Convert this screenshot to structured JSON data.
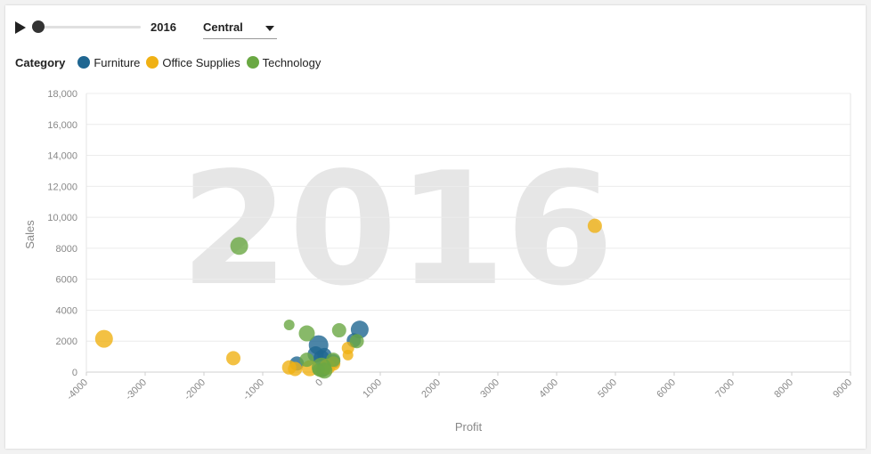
{
  "controls": {
    "year": "2016",
    "slider_progress": 0,
    "region": "Central"
  },
  "legend": {
    "title": "Category",
    "items": [
      {
        "label": "Furniture",
        "color": "#1f6691"
      },
      {
        "label": "Office Supplies",
        "color": "#f0b114"
      },
      {
        "label": "Technology",
        "color": "#6aa843"
      }
    ]
  },
  "chart_data": {
    "type": "scatter",
    "title": "",
    "watermark": "2016",
    "xlabel": "Profit",
    "ylabel": "Sales",
    "xlim": [
      -4000,
      9000
    ],
    "ylim": [
      0,
      18000
    ],
    "x_ticks": [
      "-4000",
      "-3000",
      "-2000",
      "-1000",
      "0",
      "1000",
      "2000",
      "3000",
      "4000",
      "5000",
      "6000",
      "7000",
      "8000",
      "9000"
    ],
    "y_ticks": [
      "0",
      "2000",
      "4000",
      "6000",
      "8000",
      "10,000",
      "12,000",
      "14,000",
      "16,000",
      "18,000"
    ],
    "grid": true,
    "series": [
      {
        "name": "Furniture",
        "color": "#1f6691",
        "points": [
          {
            "x": 650,
            "y": 2750,
            "size": 10
          },
          {
            "x": -50,
            "y": 1750,
            "size": 11
          },
          {
            "x": -100,
            "y": 1150,
            "size": 9
          },
          {
            "x": 0,
            "y": 900,
            "size": 9
          },
          {
            "x": 50,
            "y": 1100,
            "size": 8
          },
          {
            "x": -420,
            "y": 550,
            "size": 8
          },
          {
            "x": 200,
            "y": 700,
            "size": 8
          },
          {
            "x": 550,
            "y": 2050,
            "size": 8
          },
          {
            "x": 20,
            "y": 150,
            "size": 8
          }
        ]
      },
      {
        "name": "Office Supplies",
        "color": "#f0b114",
        "points": [
          {
            "x": 4650,
            "y": 9450,
            "size": 8
          },
          {
            "x": -3700,
            "y": 2150,
            "size": 10
          },
          {
            "x": -1500,
            "y": 900,
            "size": 8
          },
          {
            "x": -550,
            "y": 300,
            "size": 8
          },
          {
            "x": -450,
            "y": 200,
            "size": 8
          },
          {
            "x": 450,
            "y": 1550,
            "size": 7
          },
          {
            "x": 450,
            "y": 1100,
            "size": 6
          },
          {
            "x": -200,
            "y": 250,
            "size": 9
          },
          {
            "x": 100,
            "y": 350,
            "size": 9
          },
          {
            "x": 200,
            "y": 550,
            "size": 8
          }
        ]
      },
      {
        "name": "Technology",
        "color": "#6aa843",
        "points": [
          {
            "x": -1400,
            "y": 8150,
            "size": 10
          },
          {
            "x": -550,
            "y": 3050,
            "size": 6
          },
          {
            "x": -250,
            "y": 2500,
            "size": 9
          },
          {
            "x": 300,
            "y": 2700,
            "size": 8
          },
          {
            "x": 600,
            "y": 2000,
            "size": 8
          },
          {
            "x": -250,
            "y": 800,
            "size": 8
          },
          {
            "x": 200,
            "y": 800,
            "size": 8
          },
          {
            "x": 0,
            "y": 300,
            "size": 11
          },
          {
            "x": 50,
            "y": 100,
            "size": 9
          },
          {
            "x": -50,
            "y": 150,
            "size": 7
          }
        ]
      }
    ]
  }
}
